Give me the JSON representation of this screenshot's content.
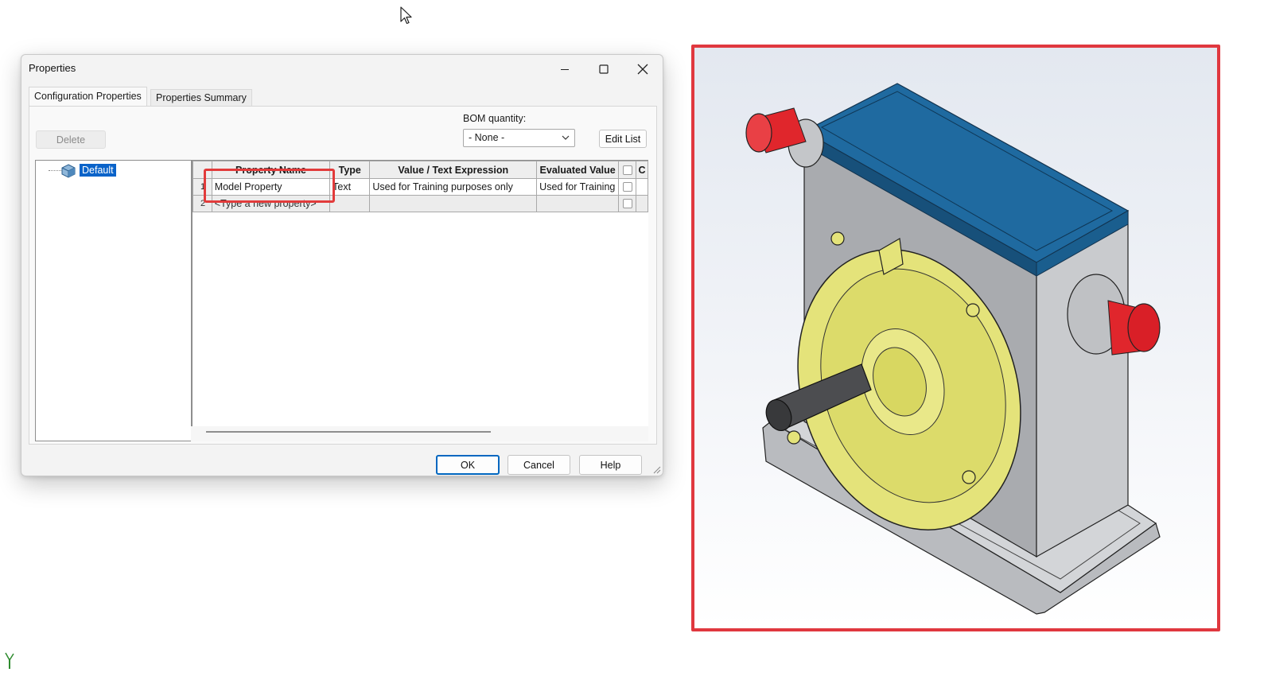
{
  "dialog": {
    "title": "Properties",
    "tabs": [
      {
        "label": "Configuration Properties",
        "active": true
      },
      {
        "label": "Properties Summary",
        "active": false
      }
    ],
    "delete_label": "Delete",
    "bom_label": "BOM quantity:",
    "bom_value": "- None -",
    "edit_list_label": "Edit List",
    "tree_item": "Default",
    "columns": [
      "",
      "Property Name",
      "Type",
      "Value / Text Expression",
      "Evaluated Value",
      "",
      "C"
    ],
    "rows": [
      {
        "num": "1",
        "name": "Model Property",
        "type": "Text",
        "value": "Used for Training purposes only",
        "evaluated": "Used for Training"
      },
      {
        "num": "2",
        "name": "<Type a new property>",
        "type": "",
        "value": "",
        "evaluated": ""
      }
    ],
    "ok_label": "OK",
    "cancel_label": "Cancel",
    "help_label": "Help"
  },
  "colors": {
    "highlight": "#e23b3b",
    "selection": "#0a63c9",
    "housing_top": "#1f6aa0",
    "flange": "#e4e37a",
    "shaft_cap": "#e0262c"
  },
  "icons": [
    "minimize-icon",
    "maximize-icon",
    "close-icon",
    "chevron-down-icon",
    "part-config-icon",
    "mouse-cursor-icon",
    "triad-icon"
  ]
}
